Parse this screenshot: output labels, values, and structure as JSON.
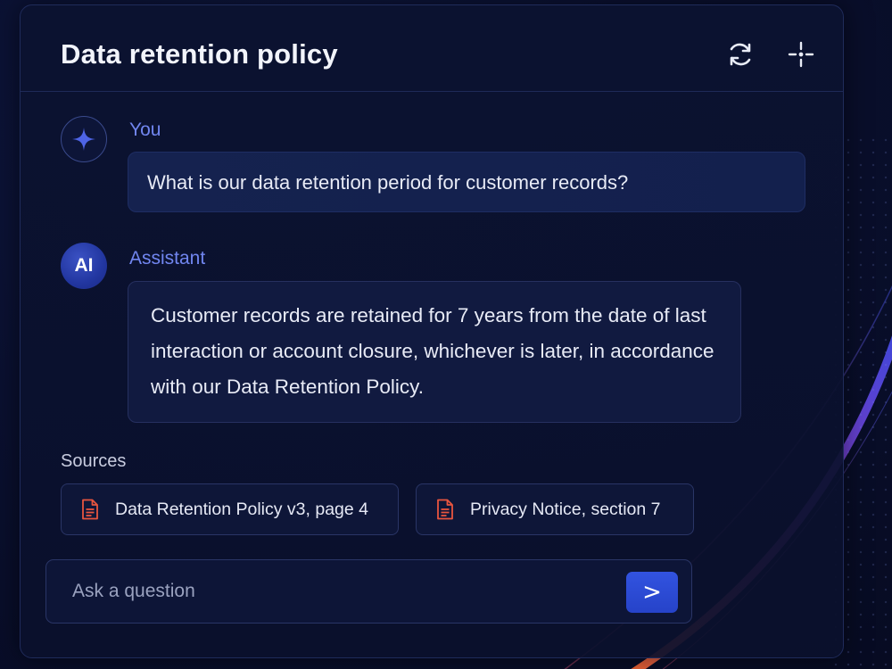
{
  "header": {
    "title": "Data retention policy",
    "refresh_icon": "refresh-icon",
    "focus_icon": "crosshair-icon"
  },
  "messages": [
    {
      "sender": "You",
      "avatar_icon": "sparkle-icon",
      "text": "What is our data retention period for customer records?"
    },
    {
      "sender": "Assistant",
      "avatar_text": "AI",
      "text": "Customer records are retained for 7 years from the date of last interaction or account closure, whichever is later, in accordance with our Data Retention Policy."
    }
  ],
  "sources": {
    "label": "Sources",
    "items": [
      {
        "label": "Data Retention Policy v3, page 4",
        "icon": "document-icon"
      },
      {
        "label": "Privacy Notice, section 7",
        "icon": "document-icon"
      }
    ]
  },
  "composer": {
    "placeholder": "Ask a question",
    "value": "",
    "send_label": ">"
  },
  "colors": {
    "accent": "#2f4fd8",
    "name_label": "#7186f0",
    "doc_icon": "#e8553f",
    "background": "#080d24"
  }
}
